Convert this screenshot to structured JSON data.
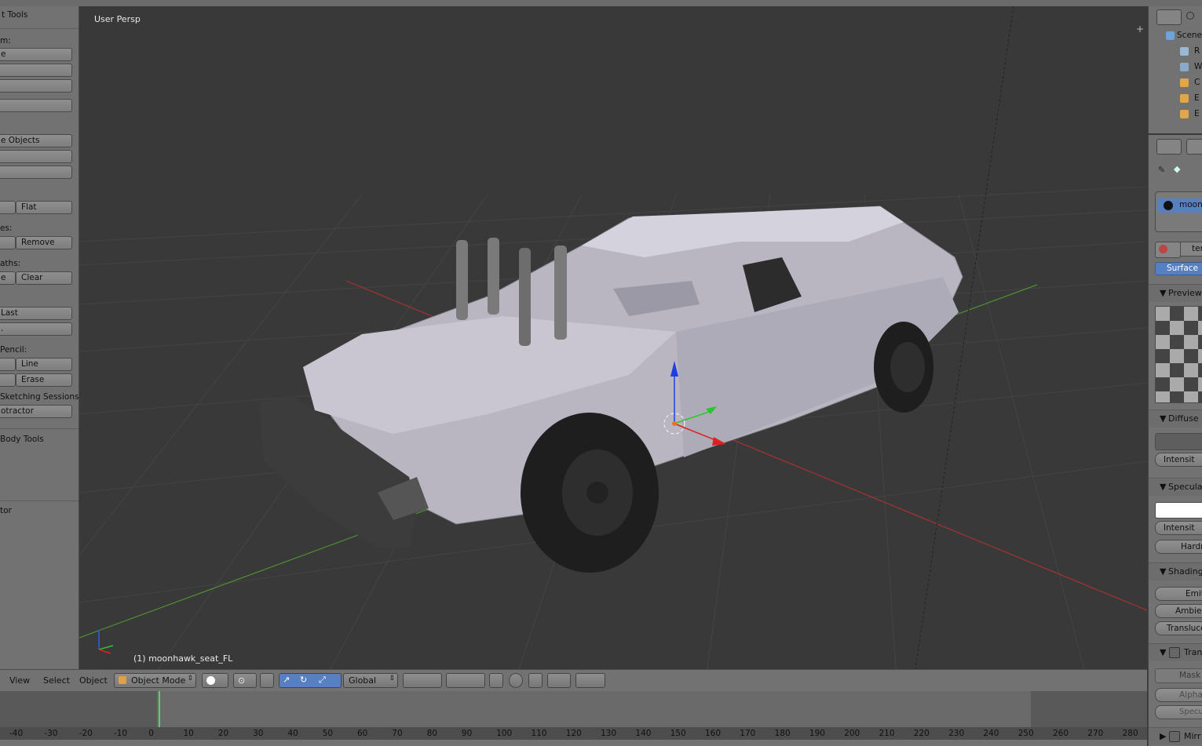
{
  "toolshelf": {
    "title": "t Tools",
    "items": [
      {
        "kind": "label",
        "text": "m:"
      },
      {
        "kind": "btn",
        "text": "e"
      },
      {
        "kind": "btn",
        "text": ""
      },
      {
        "kind": "btn",
        "text": ""
      },
      {
        "kind": "btn",
        "text": ""
      },
      {
        "kind": "btn",
        "text": "e Objects"
      },
      {
        "kind": "btn",
        "text": ""
      },
      {
        "kind": "btn",
        "text": ""
      },
      {
        "kind": "pair",
        "left": "",
        "right": "Flat"
      },
      {
        "kind": "label",
        "text": "es:"
      },
      {
        "kind": "pair",
        "left": "",
        "right": "Remove"
      },
      {
        "kind": "label",
        "text": "aths:"
      },
      {
        "kind": "pair",
        "left": "e",
        "right": "Clear"
      },
      {
        "kind": "btn",
        "text": "Last"
      },
      {
        "kind": "btn",
        "text": "."
      },
      {
        "kind": "label",
        "text": "Pencil:"
      },
      {
        "kind": "pair",
        "left": "",
        "right": "Line"
      },
      {
        "kind": "pair",
        "left": "",
        "right": "Erase"
      },
      {
        "kind": "label",
        "text": "Sketching Sessions"
      },
      {
        "kind": "btn",
        "text": "otractor"
      }
    ],
    "rigid_body": "Body Tools",
    "operator": "tor"
  },
  "viewport": {
    "view_name": "User Persp",
    "object_info": "(1) moonhawk_seat_FL"
  },
  "view3d_header": {
    "menus": [
      "View",
      "Select",
      "Object"
    ],
    "mode": "Object Mode",
    "orientation": "Global"
  },
  "timeline": {
    "ticks": [
      "-40",
      "-30",
      "-20",
      "-10",
      "0",
      "10",
      "20",
      "30",
      "40",
      "50",
      "60",
      "70",
      "80",
      "90",
      "100",
      "110",
      "120",
      "130",
      "140",
      "150",
      "160",
      "170",
      "180",
      "190",
      "200",
      "210",
      "220",
      "230",
      "240",
      "250",
      "260",
      "270",
      "280"
    ]
  },
  "outliner": {
    "rows": [
      "Scene",
      "R",
      "W",
      "C",
      "E",
      "E"
    ]
  },
  "properties": {
    "material_name": "moonh",
    "material_slot": "terio",
    "surface_tab": "Surface",
    "panels": {
      "preview": "Preview",
      "diffuse": "Diffuse",
      "diffuse_intensity": "Intensit",
      "specular": "Specula",
      "specular_intensity": "Intensit",
      "hardness": "Hardr",
      "shading": "Shading",
      "emit": "Emit",
      "ambient": "Ambien",
      "translucency": "Translucе",
      "transparency": "Tran",
      "mask": "Mask",
      "alpha": "Alpha",
      "specular_alpha": "Specul",
      "mirror": "Mirr"
    }
  },
  "colors": {
    "viewport_bg": "#393939",
    "panel_bg": "#727272",
    "accent_blue": "#5680c2",
    "axis_red": "#a83232",
    "axis_green": "#4f8f2f"
  }
}
